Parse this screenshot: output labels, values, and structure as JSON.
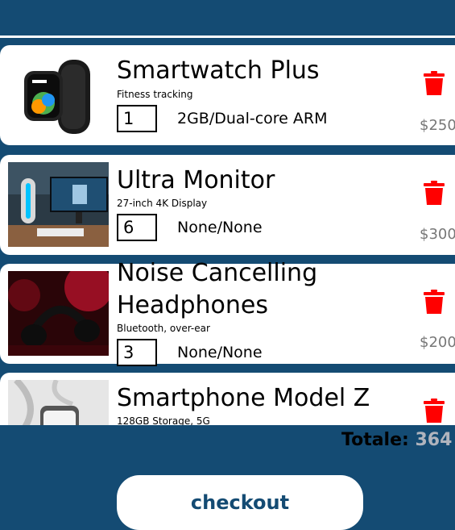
{
  "cart": {
    "items": [
      {
        "name": "Smartwatch Plus",
        "description": "Fitness tracking",
        "quantity": "1",
        "spec": "2GB/Dual-core ARM",
        "price": "$250",
        "image": "smartwatch-image"
      },
      {
        "name": "Ultra Monitor",
        "description": "27-inch 4K Display",
        "quantity": "6",
        "spec": "None/None",
        "price": "$300",
        "image": "monitor-image"
      },
      {
        "name": "Noise Cancelling Headphones",
        "description": "Bluetooth, over-ear",
        "quantity": "3",
        "spec": "None/None",
        "price": "$200",
        "image": "headphones-image"
      },
      {
        "name": "Smartphone Model Z",
        "description": "128GB Storage, 5G",
        "image": "smartphone-image"
      }
    ],
    "delete_icon": "trash-icon"
  },
  "summary": {
    "total_label": "Totale:",
    "total_value": "364"
  },
  "checkout": {
    "label": "checkout"
  },
  "colors": {
    "background": "#144b73",
    "card": "#ffffff",
    "delete": "#ff0000",
    "price": "#777777",
    "checkout_text": "#144b73",
    "total_amount": "#b0b4bd"
  }
}
